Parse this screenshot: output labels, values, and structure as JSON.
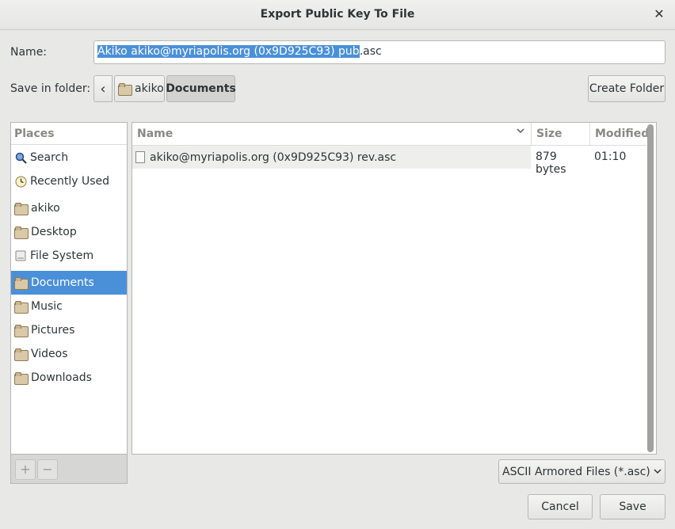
{
  "window": {
    "title": "Export Public Key To File",
    "close_glyph": "✕"
  },
  "name_row": {
    "label": "Name:",
    "value_selected": "Akiko akiko@myriapolis.org (0x9D925C93) pub",
    "value_rest": ".asc"
  },
  "folder_row": {
    "label": "Save in folder:",
    "back_glyph": "‹",
    "crumbs": [
      "akiko",
      "Documents"
    ],
    "create_folder": "Create Folder"
  },
  "places": {
    "header": "Places",
    "items": [
      {
        "label": "Search",
        "icon": "search-icon"
      },
      {
        "label": "Recently Used",
        "icon": "clock-icon"
      },
      {
        "label": "akiko",
        "icon": "home-folder-icon"
      },
      {
        "label": "Desktop",
        "icon": "desktop-folder-icon"
      },
      {
        "label": "File System",
        "icon": "drive-icon"
      },
      {
        "label": "Documents",
        "icon": "documents-folder-icon"
      },
      {
        "label": "Music",
        "icon": "music-folder-icon"
      },
      {
        "label": "Pictures",
        "icon": "pictures-folder-icon"
      },
      {
        "label": "Videos",
        "icon": "videos-folder-icon"
      },
      {
        "label": "Downloads",
        "icon": "downloads-folder-icon"
      }
    ],
    "add_glyph": "+",
    "remove_glyph": "−"
  },
  "files": {
    "columns": {
      "name": "Name",
      "size": "Size",
      "modified": "Modified"
    },
    "rows": [
      {
        "name": "akiko@myriapolis.org (0x9D925C93) rev.asc",
        "size": "879 bytes",
        "modified": "01:10"
      }
    ]
  },
  "filter": {
    "selected": "ASCII Armored Files (*.asc)"
  },
  "actions": {
    "cancel": "Cancel",
    "save": "Save"
  },
  "colors": {
    "accent": "#4a90d9",
    "background": "#e8e8e7"
  }
}
